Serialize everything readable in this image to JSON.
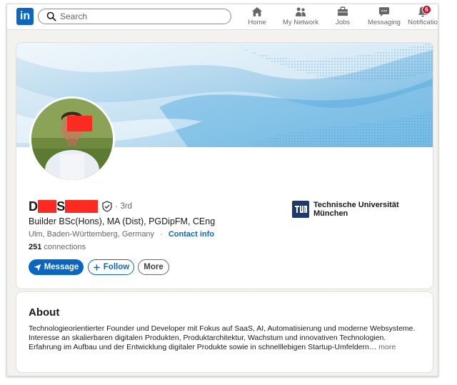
{
  "nav": {
    "logo": "in",
    "search_placeholder": "Search",
    "items": [
      {
        "label": "Home",
        "icon": "home-icon"
      },
      {
        "label": "My Network",
        "icon": "network-icon"
      },
      {
        "label": "Jobs",
        "icon": "briefcase-icon"
      },
      {
        "label": "Messaging",
        "icon": "messaging-icon"
      },
      {
        "label": "Notificatio",
        "icon": "bell-icon",
        "badge": "6"
      }
    ]
  },
  "profile": {
    "name_first_initial": "D",
    "name_last_initial": "S",
    "degree": "· 3rd",
    "headline": "Builder BSc(Hons), MA (Dist), PGDipFM, CEng",
    "location": "Ulm, Baden-Württemberg, Germany",
    "location_sep": "·",
    "contact_info": "Contact info",
    "connections_count": "251",
    "connections_label": "connections",
    "education": "Technische Universität München",
    "buttons": {
      "message": "Message",
      "follow": "Follow",
      "more": "More"
    }
  },
  "about": {
    "title": "About",
    "text": "Technologieorientierter Founder und Developer mit Fokus auf SaaS, AI, Automatisierung und moderne Websysteme. Interesse an skalierbaren digitalen Produkten, Produktarchitektur, Wachstum und innovativen Technologien.",
    "text2": "Erfahrung im Aufbau und der Entwicklung digitaler Produkte sowie in schnelllebigen Startup-Umfeldern…",
    "more": "more"
  },
  "colors": {
    "brand": "#0a66c2",
    "badge": "#cb112d",
    "redaction": "#ff2a1f"
  }
}
